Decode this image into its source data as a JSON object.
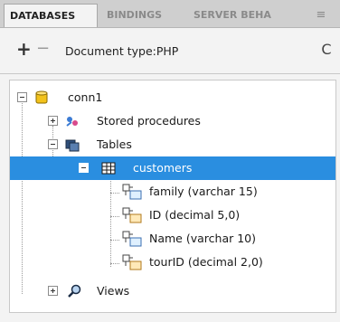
{
  "tabs": [
    {
      "label": "DATABASES",
      "active": true
    },
    {
      "label": "BINDINGS",
      "active": false
    },
    {
      "label": "SERVER BEHA",
      "active": false
    }
  ],
  "tab_menu": "≡",
  "toolbar": {
    "add_label": "+",
    "remove_label": "−",
    "document_type": "Document type:PHP",
    "refresh_label": "C"
  },
  "tree": {
    "connection": "conn1",
    "stored_procedures": "Stored procedures",
    "tables": "Tables",
    "table": "customers",
    "columns": [
      {
        "label": "family (varchar 15)",
        "type": "Dt"
      },
      {
        "label": "ID (decimal 5,0)",
        "type": "VI"
      },
      {
        "label": "Name (varchar 10)",
        "type": "Dt"
      },
      {
        "label": "tourID (decimal 2,0)",
        "type": "VI"
      }
    ],
    "views": "Views"
  },
  "colors": {
    "selection": "#2a8ee0",
    "tabbar": "#cfcfcf"
  }
}
